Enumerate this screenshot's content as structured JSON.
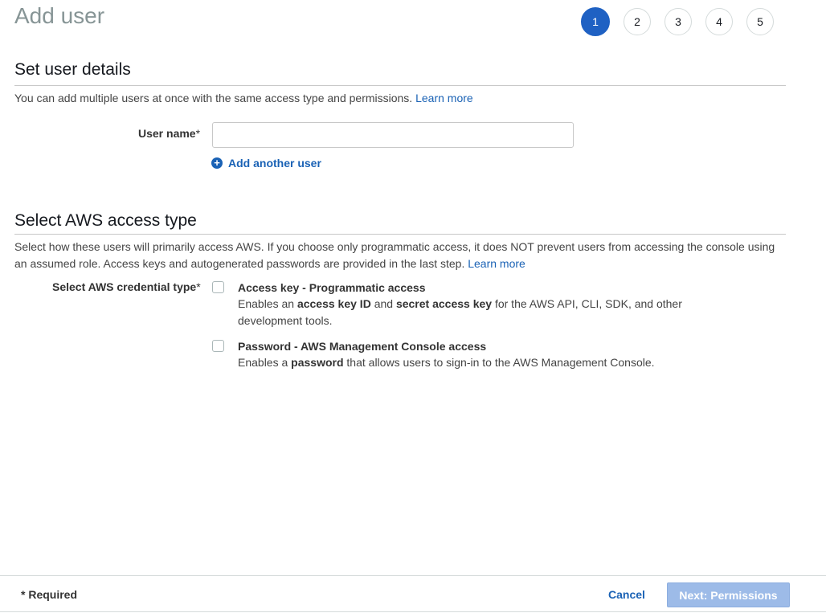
{
  "page": {
    "title": "Add user"
  },
  "steps": [
    "1",
    "2",
    "3",
    "4",
    "5"
  ],
  "user_details": {
    "heading": "Set user details",
    "description": "You can add multiple users at once with the same access type and permissions.",
    "learn_more": "Learn more",
    "user_name_label": "User name",
    "required_mark": "*",
    "user_name_value": "",
    "user_name_placeholder": "",
    "add_another_user": "Add another user"
  },
  "access_type": {
    "heading": "Select AWS access type",
    "description": "Select how these users will primarily access AWS. If you choose only programmatic access, it does NOT prevent users from accessing the console using an assumed role. Access keys and autogenerated passwords are provided in the last step.",
    "learn_more": "Learn more",
    "credential_label": "Select AWS credential type",
    "required_mark": "*",
    "options": [
      {
        "title": "Access key - Programmatic access",
        "desc_1": "Enables an ",
        "bold_1": "access key ID",
        "desc_2": " and ",
        "bold_2": "secret access key",
        "desc_3": " for the AWS API, CLI, SDK, and other development tools.",
        "checked": false
      },
      {
        "title": "Password - AWS Management Console access",
        "desc_1": "Enables a ",
        "bold_1": "password",
        "desc_2": " that allows users to sign-in to the AWS Management Console.",
        "checked": false
      }
    ]
  },
  "footer": {
    "required_note": "* Required",
    "cancel": "Cancel",
    "next": "Next: Permissions"
  },
  "colors": {
    "accent": "#1f61c3",
    "link": "#1a62b5",
    "next_button_disabled": "#9dbbe8"
  }
}
